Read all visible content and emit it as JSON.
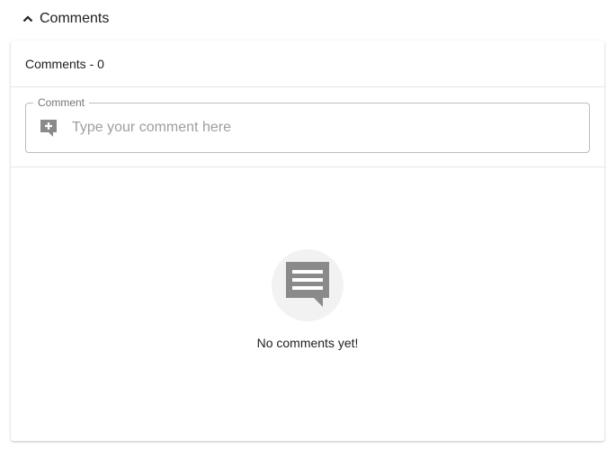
{
  "section": {
    "title": "Comments",
    "toggle_icon": "chevron-up-icon"
  },
  "card": {
    "header_label": "Comments",
    "header_separator": " - ",
    "count": "0"
  },
  "comment_input": {
    "label": "Comment",
    "placeholder": "Type your comment here",
    "value": "",
    "icon": "add-comment-icon"
  },
  "empty_state": {
    "icon": "comment-icon",
    "message": "No comments yet!"
  },
  "colors": {
    "icon_gray": "#8a8a8a",
    "empty_circle": "#f2f2f2",
    "border": "#bdbdbd"
  }
}
